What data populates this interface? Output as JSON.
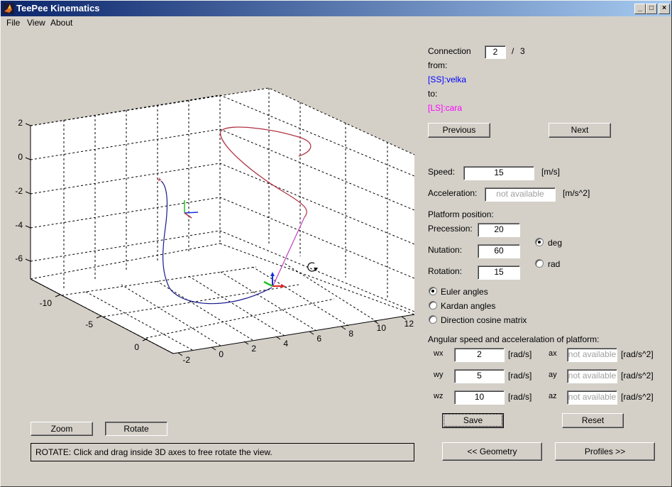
{
  "window": {
    "title": "TeePee Kinematics",
    "minimize": "_",
    "maximize": "□",
    "close": "×"
  },
  "menu": [
    "File",
    "View",
    "About"
  ],
  "plot": {
    "z_ticks": [
      "2",
      "0",
      "-2",
      "-4",
      "-6"
    ],
    "y_ticks": [
      "-10",
      "-5",
      "0"
    ],
    "x_ticks": [
      "-2",
      "0",
      "2",
      "4",
      "6",
      "8",
      "10",
      "12"
    ],
    "colors": {
      "path_ss": "#1a1a8c",
      "path_mid": "#b03040",
      "path_ls": "#c040c0",
      "axis_x": "#e02020",
      "axis_y": "#20c020",
      "axis_z": "#1030e0"
    }
  },
  "connection": {
    "label": "Connection",
    "current": "2",
    "separator": "/",
    "total": "3",
    "from_label": "from:",
    "from_value": "[SS]:velka",
    "from_color": "#0000ff",
    "to_label": "to:",
    "to_value": "[LS]:cara",
    "to_color": "#ff00ff",
    "previous": "Previous",
    "next": "Next"
  },
  "motion": {
    "speed_label": "Speed:",
    "speed_value": "15",
    "speed_unit": "[m/s]",
    "accel_label": "Acceleration:",
    "accel_value": "not available",
    "accel_unit": "[m/s^2]"
  },
  "platform": {
    "heading": "Platform position:",
    "precession_label": "Precession:",
    "precession_value": "20",
    "nutation_label": "Nutation:",
    "nutation_value": "60",
    "rotation_label": "Rotation:",
    "rotation_value": "15",
    "unit_options": [
      {
        "label": "deg",
        "selected": true
      },
      {
        "label": "rad",
        "selected": false
      }
    ],
    "representation_options": [
      {
        "label": "Euler angles",
        "selected": true
      },
      {
        "label": "Kardan angles",
        "selected": false
      },
      {
        "label": "Direction cosine matrix",
        "selected": false
      }
    ]
  },
  "angular": {
    "heading": "Angular speed and acceleralation of platform:",
    "rows": [
      {
        "w_label": "wx",
        "w_value": "2",
        "w_unit": "[rad/s]",
        "a_label": "ax",
        "a_value": "not available",
        "a_unit": "[rad/s^2]"
      },
      {
        "w_label": "wy",
        "w_value": "5",
        "w_unit": "[rad/s]",
        "a_label": "ay",
        "a_value": "not available",
        "a_unit": "[rad/s^2]"
      },
      {
        "w_label": "wz",
        "w_value": "10",
        "w_unit": "[rad/s]",
        "a_label": "az",
        "a_value": "not available",
        "a_unit": "[rad/s^2]"
      }
    ]
  },
  "buttons": {
    "save": "Save",
    "reset": "Reset",
    "geometry": "<< Geometry",
    "profiles": "Profiles >>",
    "zoom": "Zoom",
    "rotate": "Rotate"
  },
  "status": "ROTATE: Click and drag inside 3D axes to free rotate the view."
}
